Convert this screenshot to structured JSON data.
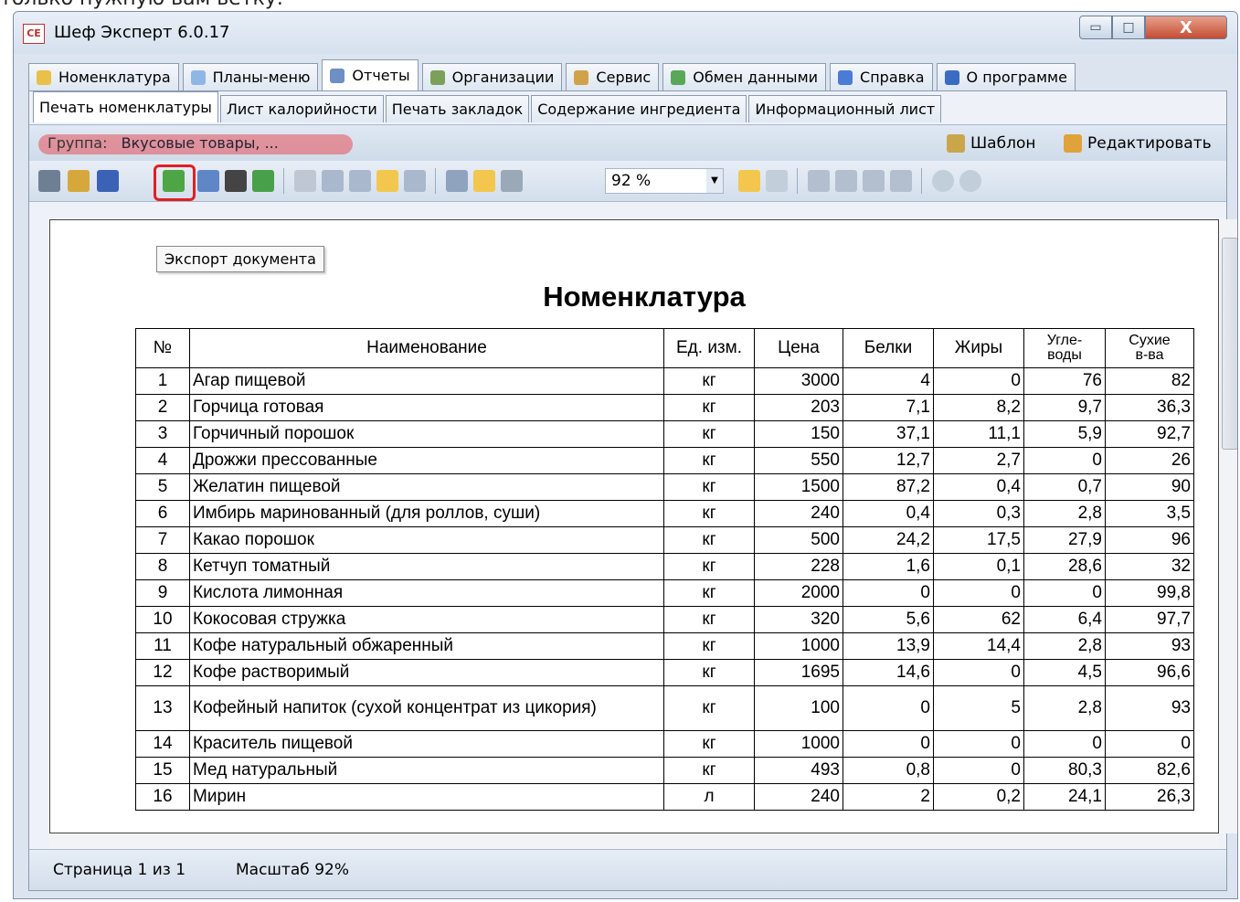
{
  "background_text": "только нужную вам ветку.",
  "window": {
    "title": "Шеф Эксперт 6.0.17",
    "app_icon_text": "CE",
    "minimize": "▭",
    "maximize": "□",
    "close": "X"
  },
  "main_tabs": [
    {
      "label": "Номенклатура",
      "color": "#e8c04a"
    },
    {
      "label": "Планы-меню",
      "color": "#8fb7e6"
    },
    {
      "label": "Отчеты",
      "color": "#6e8fc3"
    },
    {
      "label": "Организации",
      "color": "#7aa05a"
    },
    {
      "label": "Сервис",
      "color": "#d0a24a"
    },
    {
      "label": "Обмен данными",
      "color": "#58a858"
    },
    {
      "label": "Справка",
      "color": "#4c7bd6"
    },
    {
      "label": "О программе",
      "color": "#3a6cc4"
    }
  ],
  "sub_tabs": [
    "Печать номенклатуры",
    "Лист калорийности",
    "Печать закладок",
    "Содержание ингредиента",
    "Информационный лист"
  ],
  "group": {
    "label": "Группа:",
    "value": "Вкусовые товары, ...",
    "template_label": "Шаблон",
    "edit_label": "Редактировать"
  },
  "toolbar": {
    "zoom_value": "92 %",
    "tooltip": "Экспорт документа"
  },
  "document": {
    "title": "Номенклатура",
    "headers": [
      "№",
      "Наименование",
      "Ед. изм.",
      "Цена",
      "Белки",
      "Жиры",
      "Угле-\nводы",
      "Сухие\nв-ва"
    ],
    "rows": [
      [
        "1",
        "Агар пищевой",
        "кг",
        "3000",
        "4",
        "0",
        "76",
        "82"
      ],
      [
        "2",
        "Горчица готовая",
        "кг",
        "203",
        "7,1",
        "8,2",
        "9,7",
        "36,3"
      ],
      [
        "3",
        "Горчичный порошок",
        "кг",
        "150",
        "37,1",
        "11,1",
        "5,9",
        "92,7"
      ],
      [
        "4",
        "Дрожжи прессованные",
        "кг",
        "550",
        "12,7",
        "2,7",
        "0",
        "26"
      ],
      [
        "5",
        "Желатин пищевой",
        "кг",
        "1500",
        "87,2",
        "0,4",
        "0,7",
        "90"
      ],
      [
        "6",
        "Имбирь маринованный (для роллов, суши)",
        "кг",
        "240",
        "0,4",
        "0,3",
        "2,8",
        "3,5"
      ],
      [
        "7",
        "Какао порошок",
        "кг",
        "500",
        "24,2",
        "17,5",
        "27,9",
        "96"
      ],
      [
        "8",
        "Кетчуп томатный",
        "кг",
        "228",
        "1,6",
        "0,1",
        "28,6",
        "32"
      ],
      [
        "9",
        "Кислота лимонная",
        "кг",
        "2000",
        "0",
        "0",
        "0",
        "99,8"
      ],
      [
        "10",
        "Кокосовая стружка",
        "кг",
        "320",
        "5,6",
        "62",
        "6,4",
        "97,7"
      ],
      [
        "11",
        "Кофе натуральный обжаренный",
        "кг",
        "1000",
        "13,9",
        "14,4",
        "2,8",
        "93"
      ],
      [
        "12",
        "Кофе растворимый",
        "кг",
        "1695",
        "14,6",
        "0",
        "4,5",
        "96,6"
      ],
      [
        "13",
        "Кофейный напиток (сухой концентрат из цикория)",
        "кг",
        "100",
        "0",
        "5",
        "2,8",
        "93"
      ],
      [
        "14",
        "Краситель пищевой",
        "кг",
        "1000",
        "0",
        "0",
        "0",
        "0"
      ],
      [
        "15",
        "Мед натуральный",
        "кг",
        "493",
        "0,8",
        "0",
        "80,3",
        "82,6"
      ],
      [
        "16",
        "Мирин",
        "л",
        "240",
        "2",
        "0,2",
        "24,1",
        "26,3"
      ]
    ]
  },
  "status": {
    "page": "Страница 1 из 1",
    "scale": "Масштаб 92%"
  }
}
